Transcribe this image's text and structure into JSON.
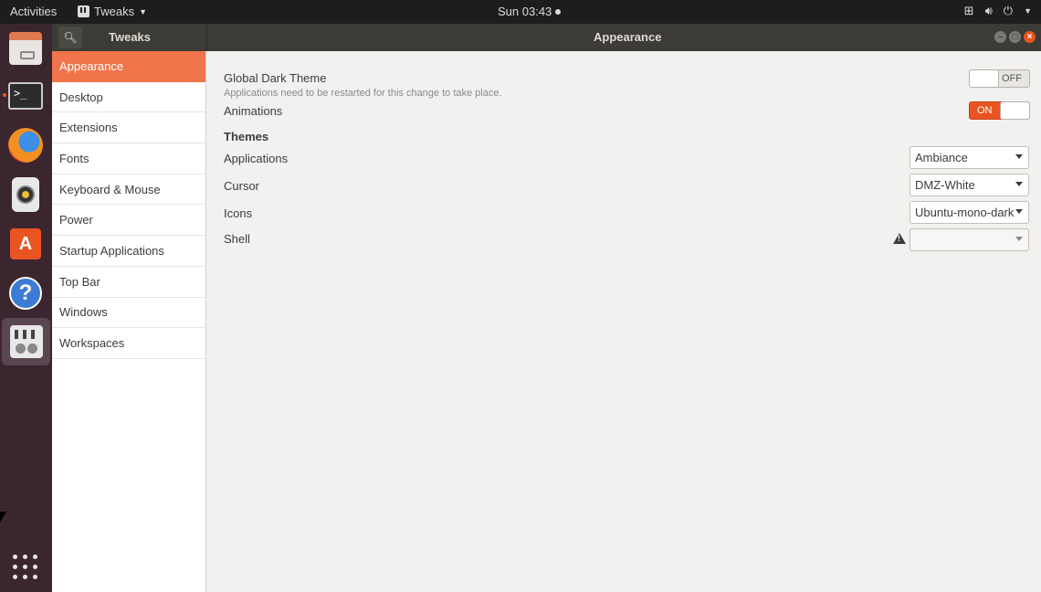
{
  "topbar": {
    "activities": "Activities",
    "app_name": "Tweaks",
    "clock": "Sun 03:43"
  },
  "dock": {
    "items": [
      "files-icon",
      "terminal-icon",
      "firefox-icon",
      "rhythmbox-icon",
      "software-store-icon",
      "help-icon",
      "tweaks-icon"
    ],
    "terminal_prompt": ">_",
    "store_letter": "A",
    "help_glyph": "?"
  },
  "header": {
    "left_title": "Tweaks",
    "main_title": "Appearance"
  },
  "sidebar": {
    "items": [
      {
        "label": "Appearance"
      },
      {
        "label": "Desktop"
      },
      {
        "label": "Extensions"
      },
      {
        "label": "Fonts"
      },
      {
        "label": "Keyboard & Mouse"
      },
      {
        "label": "Power"
      },
      {
        "label": "Startup Applications"
      },
      {
        "label": "Top Bar"
      },
      {
        "label": "Windows"
      },
      {
        "label": "Workspaces"
      }
    ],
    "selected": "Appearance"
  },
  "main": {
    "global_dark": {
      "label": "Global Dark Theme",
      "sublabel": "Applications need to be restarted for this change to take place.",
      "state": "OFF"
    },
    "animations": {
      "label": "Animations",
      "state": "ON"
    },
    "themes_title": "Themes",
    "applications": {
      "label": "Applications",
      "value": "Ambiance"
    },
    "cursor": {
      "label": "Cursor",
      "value": "DMZ-White"
    },
    "icons": {
      "label": "Icons",
      "value": "Ubuntu-mono-dark"
    },
    "shell": {
      "label": "Shell",
      "value": ""
    }
  },
  "colors": {
    "accent": "#e95420",
    "selected_row": "#f0754a",
    "topbar": "#1d1d1d",
    "headerbar": "#3c3b37",
    "dock": "#3b2630"
  }
}
